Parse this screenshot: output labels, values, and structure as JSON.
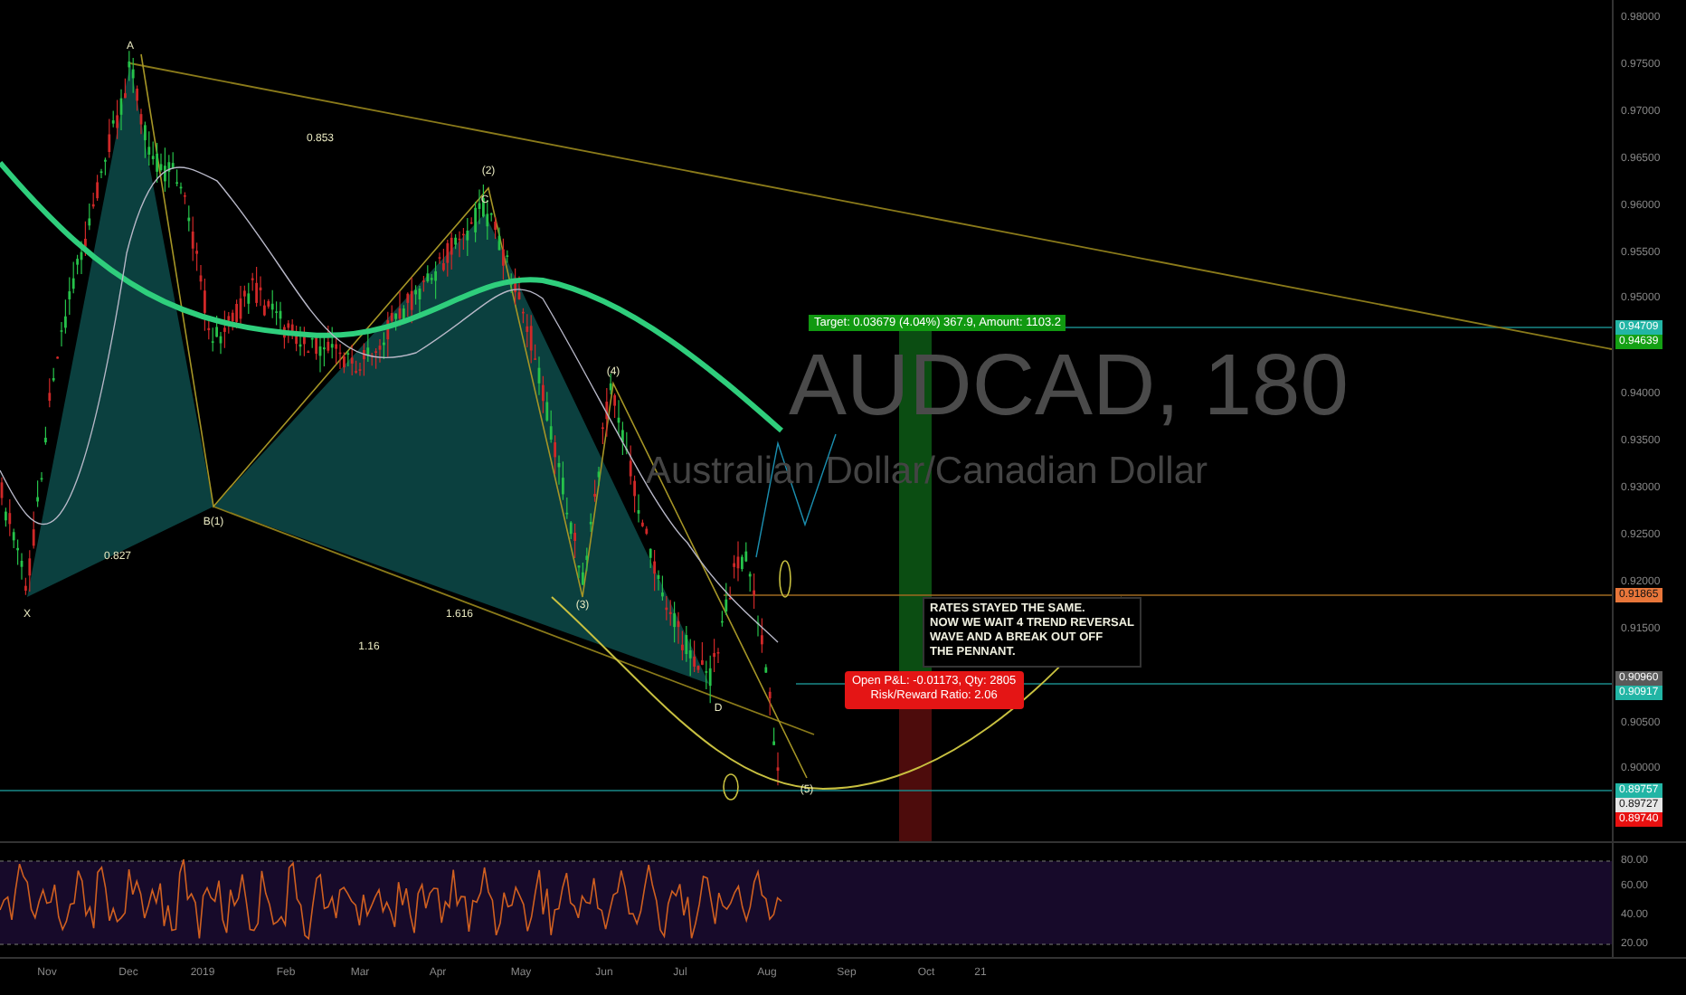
{
  "symbol_watermark": {
    "ticker": "AUDCAD, 180",
    "description": "Australian Dollar/Canadian Dollar"
  },
  "pattern_labels": [
    {
      "text": "A"
    },
    {
      "text": "X"
    },
    {
      "text": "B(1)"
    },
    {
      "text": "C"
    },
    {
      "text": "(2)"
    },
    {
      "text": "(3)"
    },
    {
      "text": "(4)"
    },
    {
      "text": "D"
    },
    {
      "text": "(5)"
    },
    {
      "text": "0.853"
    },
    {
      "text": "0.827"
    },
    {
      "text": "1.616"
    },
    {
      "text": "1.16"
    }
  ],
  "target_label": {
    "text": "Target: 0.03679 (4.04%) 367.9, Amount: 1103.2"
  },
  "pnl_label": {
    "lines": [
      "Open P&L: -0.01173, Qty: 2805",
      "Risk/Reward Ratio: 2.06"
    ]
  },
  "note": {
    "lines": [
      "RATES STAYED THE SAME.",
      "NOW WE WAIT 4 TREND REVERSAL",
      "WAVE AND A BREAK OUT OFF",
      "THE PENNANT."
    ]
  },
  "price_axis": [
    {
      "kind": "tick",
      "text": "0.98000"
    },
    {
      "kind": "tick",
      "text": "0.97500"
    },
    {
      "kind": "tick",
      "text": "0.97000"
    },
    {
      "kind": "tick",
      "text": "0.96500"
    },
    {
      "kind": "tick",
      "text": "0.96000"
    },
    {
      "kind": "tick",
      "text": "0.95500"
    },
    {
      "kind": "tick",
      "text": "0.95000"
    },
    {
      "kind": "badge",
      "text": "0.94709",
      "color": "#22b5a5"
    },
    {
      "kind": "badge",
      "text": "0.94639",
      "color": "#14a014"
    },
    {
      "kind": "tick",
      "text": "0.94000"
    },
    {
      "kind": "tick",
      "text": "0.93500"
    },
    {
      "kind": "tick",
      "text": "0.93000"
    },
    {
      "kind": "tick",
      "text": "0.92500"
    },
    {
      "kind": "tick",
      "text": "0.92000"
    },
    {
      "kind": "badge",
      "text": "0.91865",
      "color": "#e8763a"
    },
    {
      "kind": "tick",
      "text": "0.91500"
    },
    {
      "kind": "badge",
      "text": "0.90960",
      "color": "#5a5a5a"
    },
    {
      "kind": "badge",
      "text": "0.90917",
      "color": "#22b5a5"
    },
    {
      "kind": "tick",
      "text": "0.90500"
    },
    {
      "kind": "tick",
      "text": "0.90000"
    },
    {
      "kind": "badge",
      "text": "0.89757",
      "color": "#22b5a5"
    },
    {
      "kind": "badge",
      "text": "0.89727",
      "color": "#e6e6e6"
    },
    {
      "kind": "badge",
      "text": "0.89740",
      "color": "#e81010"
    }
  ],
  "rsi_axis": [
    "80.00",
    "60.00",
    "40.00",
    "20.00"
  ],
  "time_axis": [
    "Nov",
    "Dec",
    "2019",
    "Feb",
    "Mar",
    "Apr",
    "May",
    "Jun",
    "Jul",
    "Aug",
    "Sep",
    "Oct",
    "21"
  ]
}
